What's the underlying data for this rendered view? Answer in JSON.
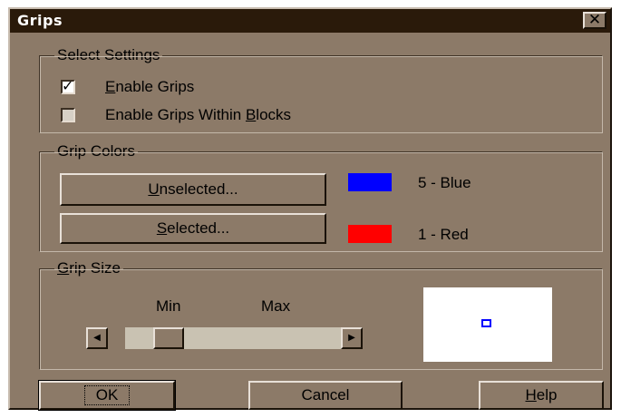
{
  "window": {
    "title": "Grips",
    "close_icon": "close-icon"
  },
  "select_settings": {
    "legend": "Select Settings",
    "enable_grips": {
      "label": "Enable Grips",
      "checked": true
    },
    "enable_grips_within_blocks": {
      "label": "Enable Grips Within Blocks",
      "checked": false
    }
  },
  "grip_colors": {
    "legend": "Grip Colors",
    "unselected": {
      "button_label": "Unselected...",
      "color_name": "5 - Blue",
      "color": "#0000ff"
    },
    "selected": {
      "button_label": "Selected...",
      "color_name": "1 - Red",
      "color": "#ff0000"
    }
  },
  "grip_size": {
    "legend": "Grip Size",
    "min_label": "Min",
    "max_label": "Max",
    "left_arrow_icon": "left-arrow-icon",
    "right_arrow_icon": "right-arrow-icon",
    "slider_value_fraction": 0.15,
    "preview_color": "#0000ff"
  },
  "buttons": {
    "ok": "OK",
    "cancel": "Cancel",
    "help": "Help"
  },
  "colors": {
    "dialog_bg": "#8c7a68",
    "titlebar_bg": "#2a1a0a",
    "title_text": "#ffffff"
  }
}
